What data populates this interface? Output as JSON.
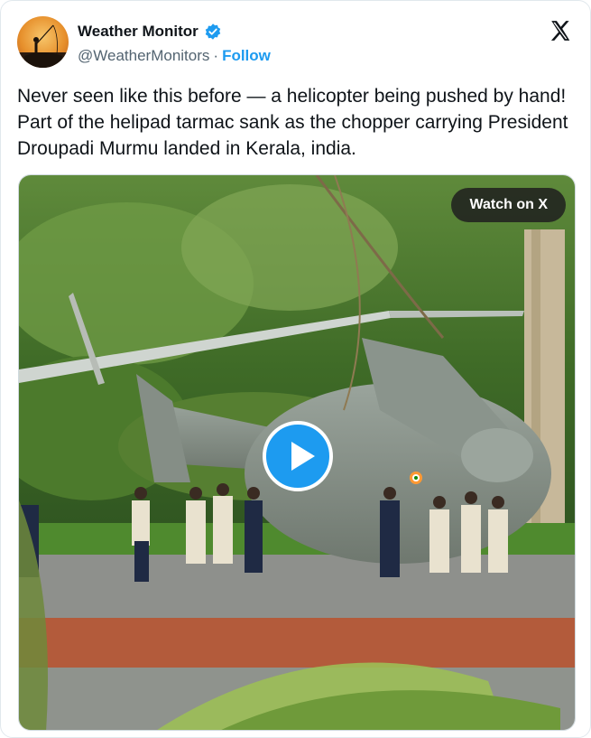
{
  "tweet": {
    "author_name": "Weather Monitor",
    "handle": "@WeatherMonitors",
    "separator": "·",
    "follow_label": "Follow",
    "text": "Never seen like this before — a helicopter being pushed by hand! Part of the helipad tarmac sank as the chopper carrying President Droupadi Murmu landed in Kerala, india."
  },
  "media": {
    "watch_label": "Watch on X"
  },
  "icons": {
    "verified": "verified-badge-icon",
    "platform": "x-logo-icon",
    "play": "play-icon"
  },
  "colors": {
    "accent": "#1d9bf0",
    "text": "#0f1419",
    "muted": "#536471"
  }
}
